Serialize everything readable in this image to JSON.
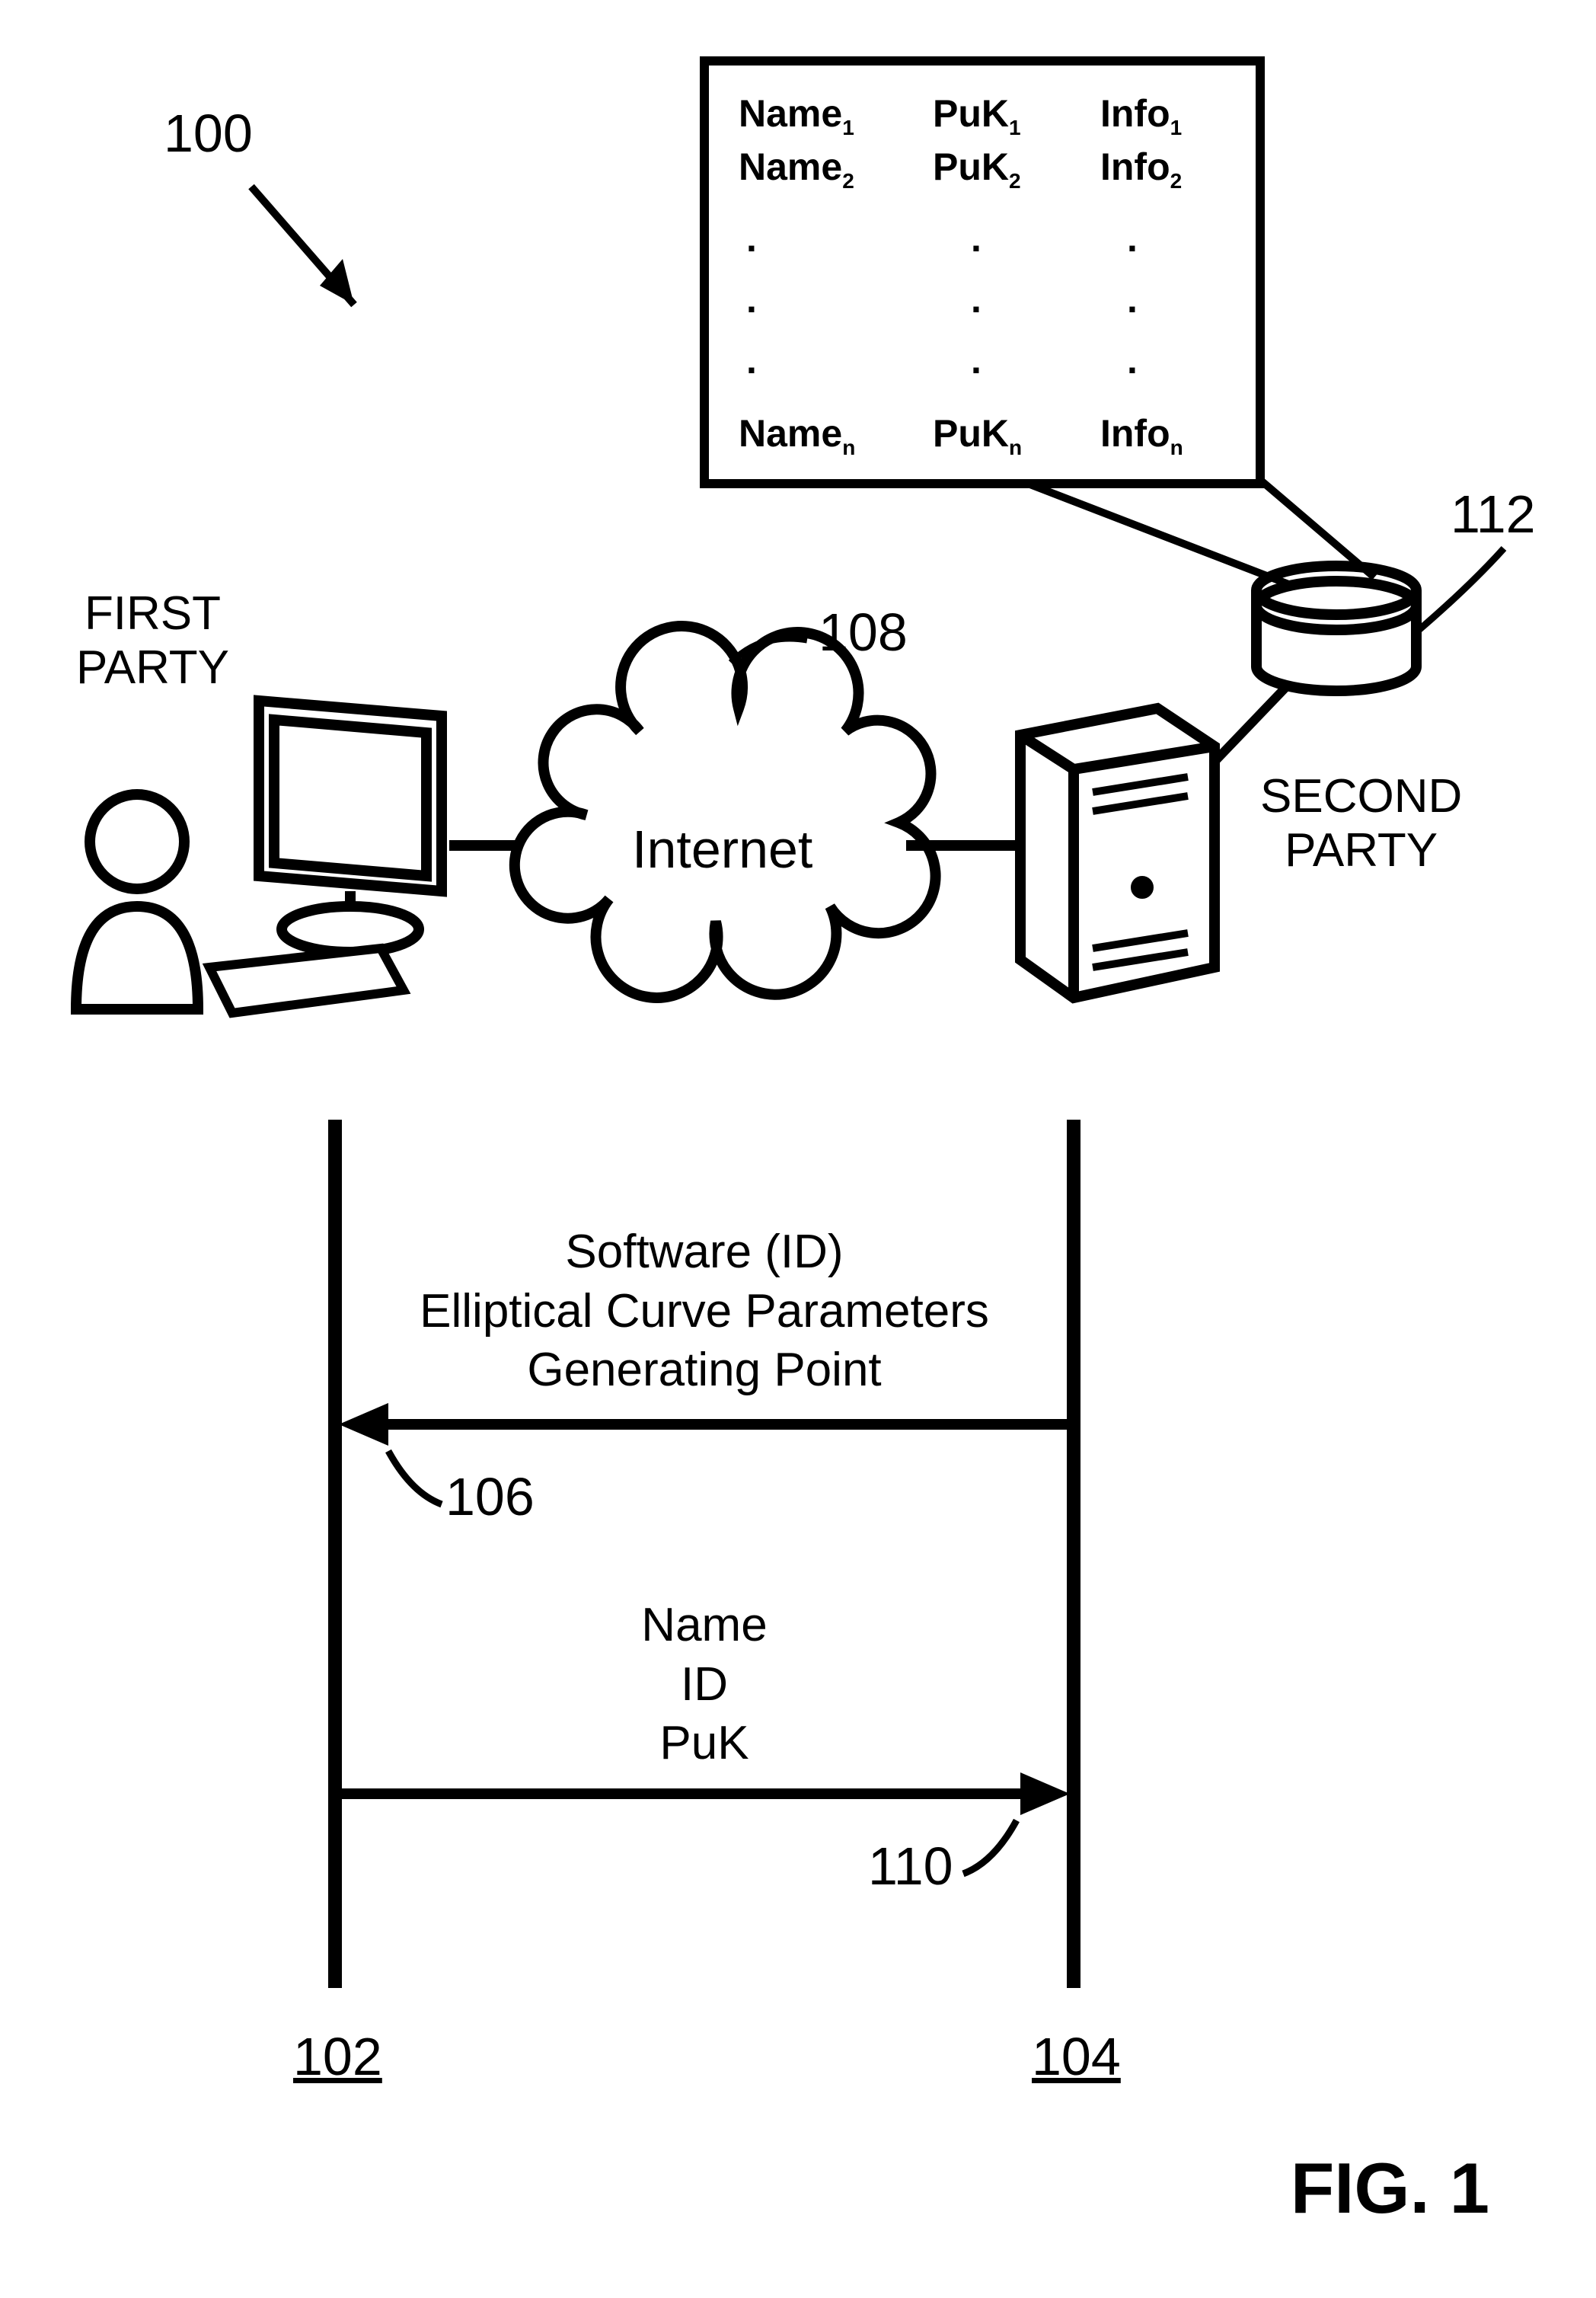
{
  "figure": {
    "caption": "FIG. 1",
    "reference_numeral_main": "100"
  },
  "parties": {
    "first": "FIRST\nPARTY",
    "second": "SECOND\nPARTY"
  },
  "cloud": {
    "label": "Internet",
    "ref": "108"
  },
  "database": {
    "ref": "112"
  },
  "table": {
    "rows": [
      {
        "c1": "Name",
        "c1s": "1",
        "c2": "PuK",
        "c2s": "1",
        "c3": "Info",
        "c3s": "1"
      },
      {
        "c1": "Name",
        "c1s": "2",
        "c2": "PuK",
        "c2s": "2",
        "c3": "Info",
        "c3s": "2"
      },
      {
        "c1": "Name",
        "c1s": "n",
        "c2": "PuK",
        "c2s": "n",
        "c3": "Info",
        "c3s": "n"
      }
    ]
  },
  "sequence": {
    "left_lifeline_ref": "102",
    "right_lifeline_ref": "104",
    "msg1": {
      "lines": [
        "Software (ID)",
        "Elliptical Curve Parameters",
        "Generating Point"
      ],
      "ref": "106"
    },
    "msg2": {
      "lines": [
        "Name",
        "ID",
        "PuK"
      ],
      "ref": "110"
    }
  }
}
